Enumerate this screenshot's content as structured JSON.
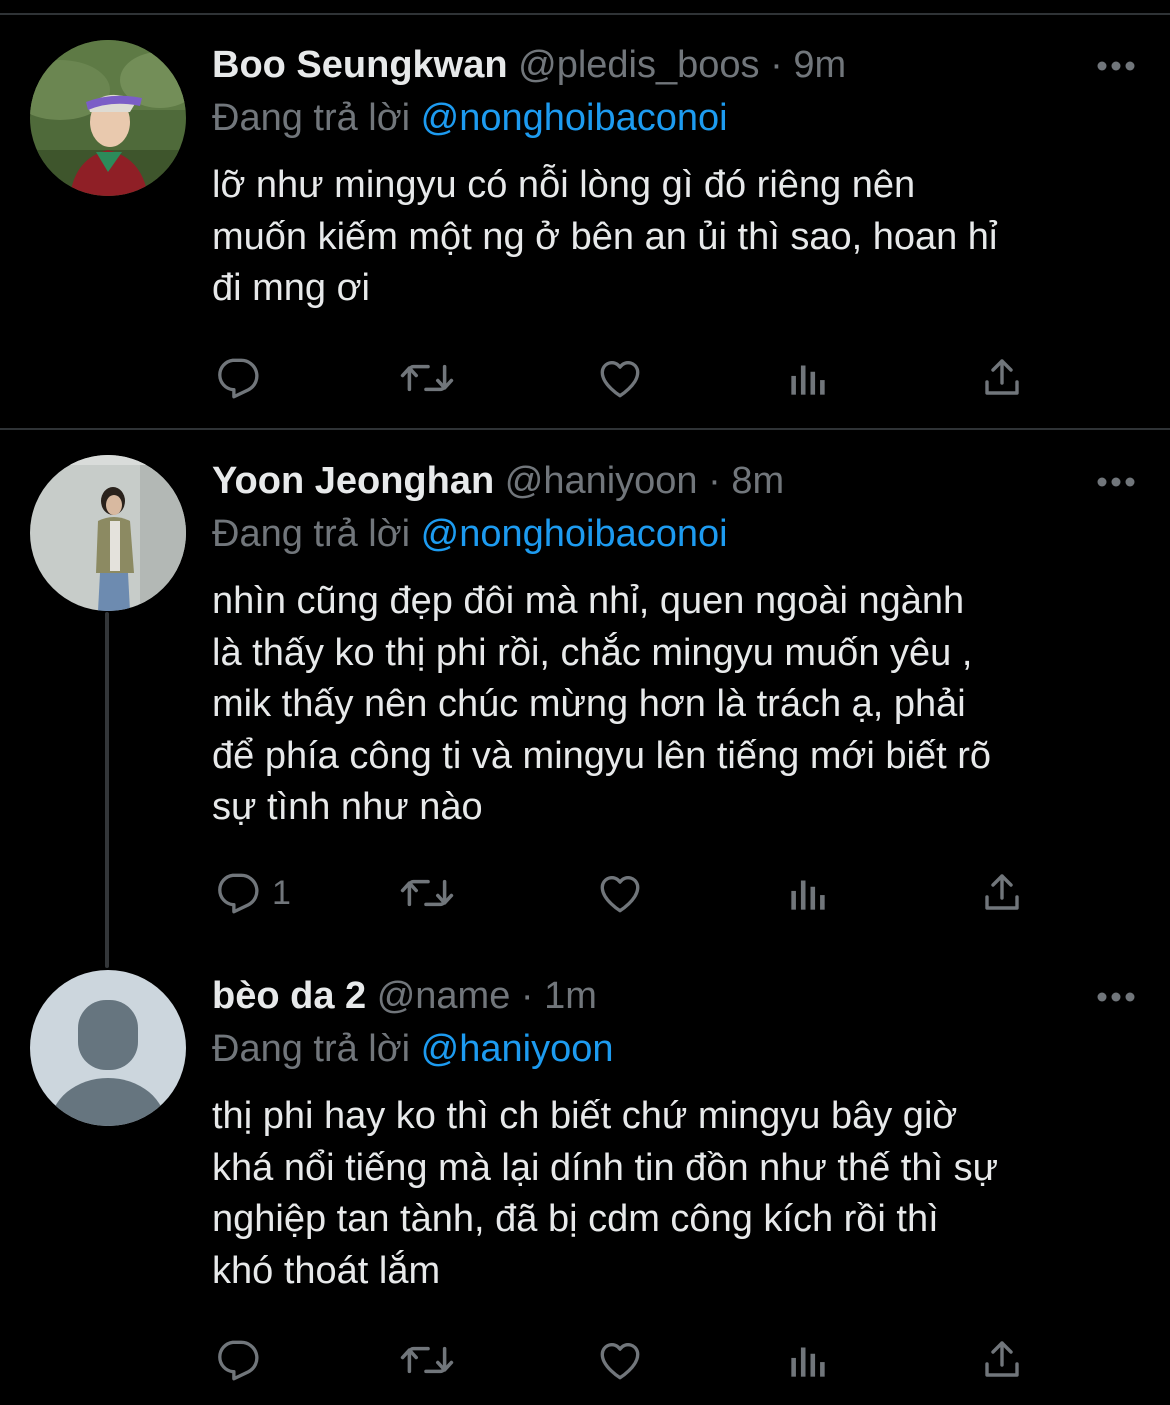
{
  "reply_prefix": "Đang trả lời",
  "sep": "·",
  "colors": {
    "background": "#000000",
    "text": "#e7e9ea",
    "muted": "#71767b",
    "mention": "#1d9bf0",
    "divider": "#2f3336"
  },
  "icons": [
    "reply-icon",
    "retweet-icon",
    "like-icon",
    "views-icon",
    "share-icon",
    "more-icon"
  ],
  "tweets": [
    {
      "name": "Boo Seungkwan",
      "handle": "@pledis_boos",
      "time": "9m",
      "reply_to": "@nonghoibaconoi",
      "lines": [
        "lỡ như mingyu có nỗi lòng gì đó riêng nên",
        "muốn kiếm một ng ở bên an ủi thì sao, hoan hỉ",
        "đi mng ơi"
      ],
      "reply_count": ""
    },
    {
      "name": "Yoon Jeonghan",
      "handle": "@haniyoon",
      "time": "8m",
      "reply_to": "@nonghoibaconoi",
      "lines": [
        "nhìn cũng đẹp đôi mà nhỉ, quen ngoài ngành",
        "là thấy ko thị phi rồi, chắc mingyu muốn yêu ,",
        "mik thấy nên chúc mừng hơn là trách ạ, phải",
        "để phía công ti và mingyu lên tiếng mới biết rõ",
        "sự tình như nào"
      ],
      "reply_count": "1"
    },
    {
      "name": "bèo da 2",
      "handle": "@name",
      "time": "1m",
      "reply_to": "@haniyoon",
      "lines": [
        "thị phi hay ko thì ch biết chứ mingyu bây giờ",
        "khá nổi tiếng mà lại dính tin đồn như thế thì sự",
        "nghiệp tan tành, đã bị cdm công kích rồi thì",
        "khó thoát lắm"
      ],
      "reply_count": ""
    }
  ]
}
